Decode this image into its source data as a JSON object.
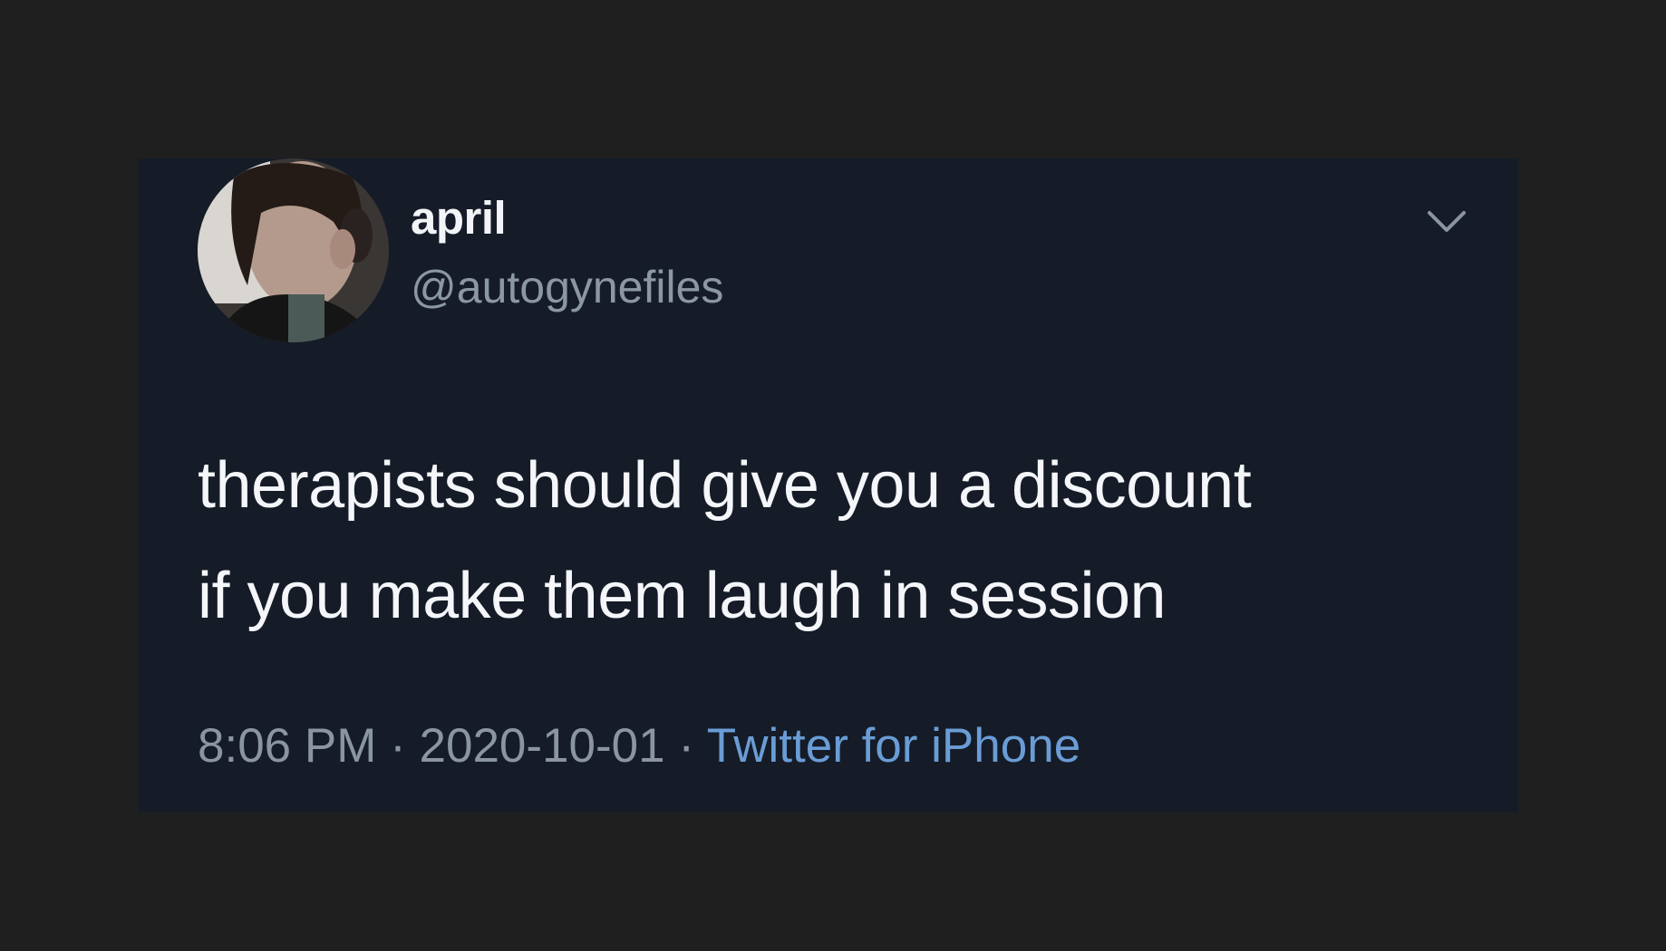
{
  "tweet": {
    "display_name": "april",
    "handle": "@autogynefiles",
    "text_line1": "therapists should give you a discount",
    "text_line2": "if you make them laugh in session",
    "time": "8:06 PM",
    "separator": " · ",
    "date": "2020-10-01",
    "source": "Twitter for iPhone"
  },
  "icons": {
    "avatar": "profile-photo",
    "menu": "chevron-down-icon"
  },
  "colors": {
    "page_background": "#1f1f1f",
    "card_background": "#151c28",
    "text_primary": "#f4f6f9",
    "text_secondary": "#8b95a2",
    "link": "#6a9dd6"
  }
}
